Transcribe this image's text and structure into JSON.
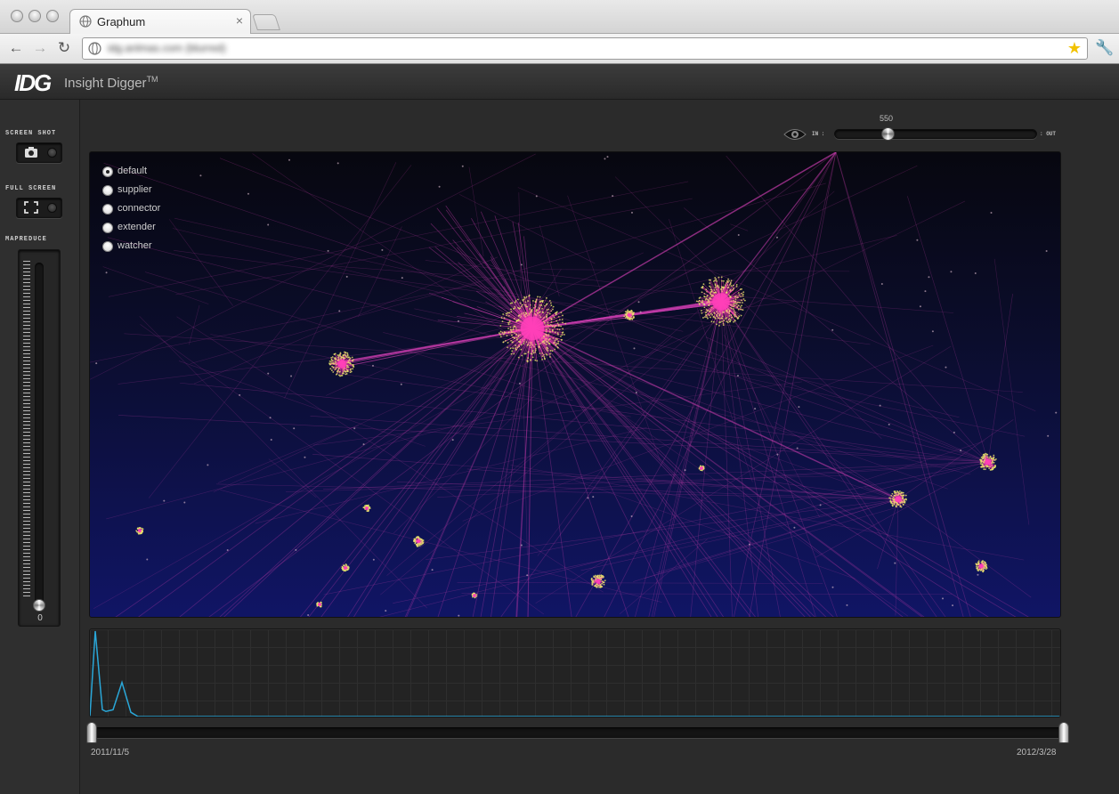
{
  "browser": {
    "tab_title": "Graphum",
    "tab_close": "×",
    "url": "idg.anlmas.com (blurred)",
    "nav": {
      "back": "←",
      "forward": "→",
      "reload": "↻"
    }
  },
  "app": {
    "logo": "IDG",
    "name": "Insight Digger",
    "trademark": "TM"
  },
  "sidebar": {
    "screenshot_label": "SCREEN SHOT",
    "fullscreen_label": "FULL SCREEN",
    "mapreduce_label": "MAPREDUCE",
    "mapreduce_value": "0",
    "mapreduce_level": 0
  },
  "zoom": {
    "value": "550",
    "in_label": "IN :",
    "out_label": ": OUT",
    "level_fraction": 0.27
  },
  "filters": {
    "options": [
      "default",
      "supplier",
      "connector",
      "extender",
      "watcher"
    ],
    "selected": "default"
  },
  "timeline": {
    "start_date": "2011/11/5",
    "end_date": "2012/3/28",
    "line_color": "#2aa7d8",
    "series": [
      0,
      100,
      8,
      6,
      8,
      40,
      5,
      0,
      0,
      0
    ]
  },
  "colors": {
    "node": "#ff3fb8",
    "edge": "#c23aa8",
    "halo": "#e8e86a",
    "graph_top": "#07070f",
    "graph_bottom": "#101565"
  }
}
